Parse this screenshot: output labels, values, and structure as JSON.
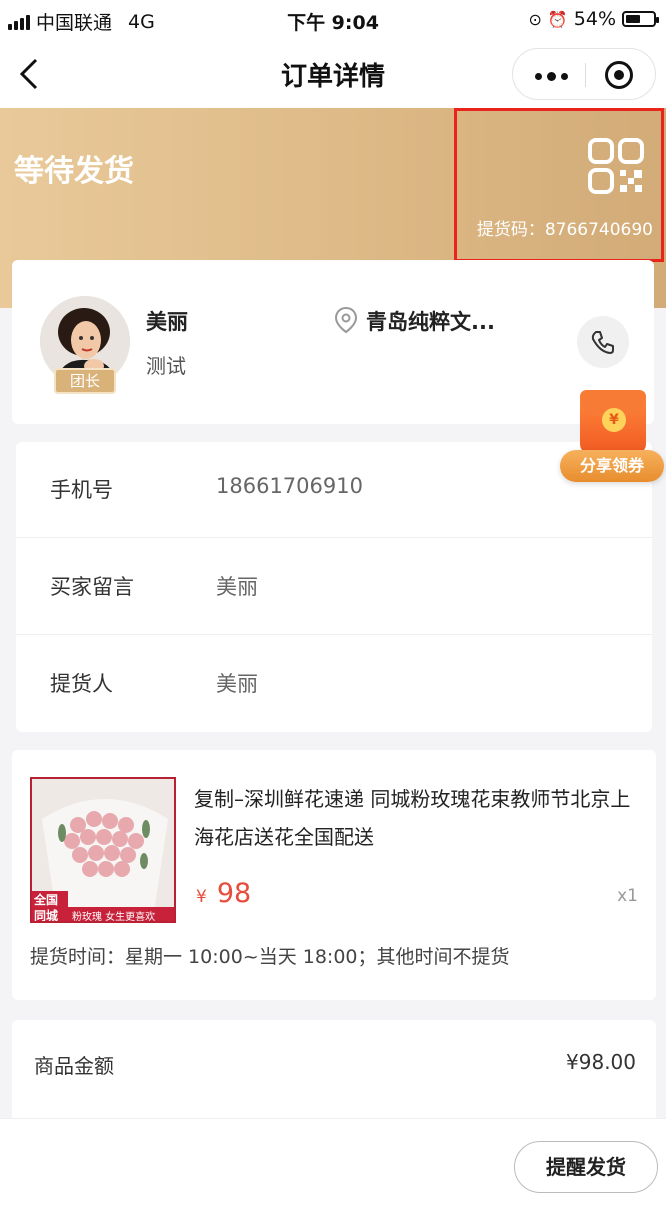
{
  "status_bar": {
    "carrier": "中国联通",
    "network": "4G",
    "time": "下午 9:04",
    "battery": "54%",
    "battery_level": 0.54
  },
  "nav": {
    "title": "订单详情"
  },
  "order": {
    "status": "等待发货",
    "pickup_code": "提货码：8766740690"
  },
  "leader": {
    "name": "美丽",
    "note": "测试",
    "badge": "团长",
    "store": "青岛纯粹文..."
  },
  "info_rows": [
    {
      "label": "手机号",
      "value": "18661706910"
    },
    {
      "label": "买家留言",
      "value": "美丽"
    },
    {
      "label": "提货人",
      "value": "美丽"
    }
  ],
  "product": {
    "title": "复制–深圳鲜花速递 同城粉玫瑰花束教师节北京上海花店送花全国配送",
    "currency": "¥",
    "price": "98",
    "quantity": "x1",
    "image_tag_1": "全国",
    "image_tag_2": "同城",
    "image_caption": "粉玫瑰 女生更喜欢",
    "pickup_time": "提货时间：星期一 10:00~当天 18:00；其他时间不提货"
  },
  "amount": {
    "label": "商品金额",
    "value": "¥98.00"
  },
  "promo": {
    "label": "分享领券",
    "coin": "¥"
  },
  "actions": {
    "remind": "提醒发货"
  },
  "colors": {
    "banner": "#ddb986",
    "price": "#e74c3c",
    "highlight": "#e8241c"
  }
}
